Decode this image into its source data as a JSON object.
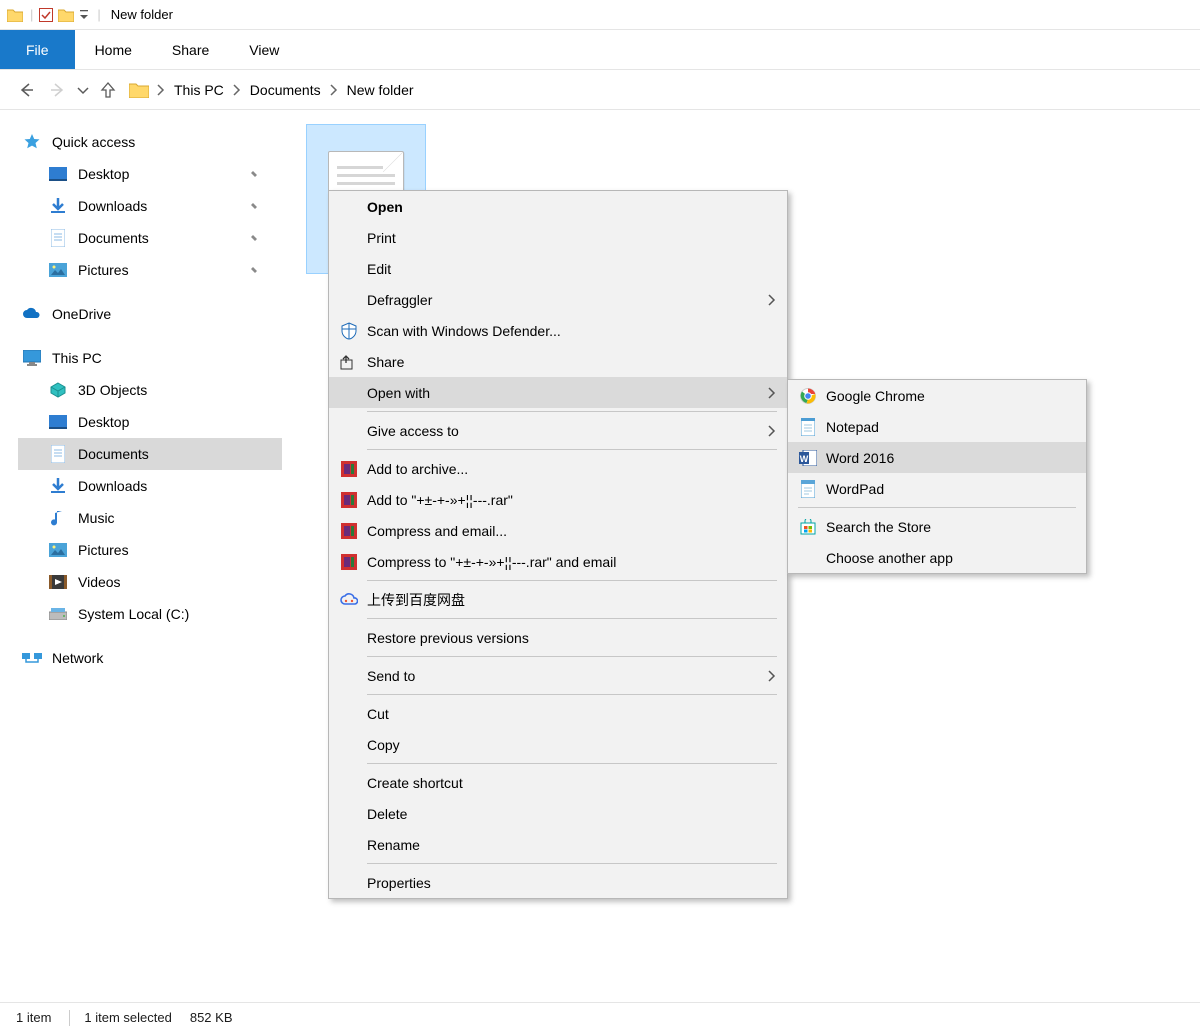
{
  "titlebar": {
    "title": "New folder"
  },
  "ribbon": {
    "file": "File",
    "tabs": [
      "Home",
      "Share",
      "View"
    ]
  },
  "breadcrumb": {
    "segments": [
      "This PC",
      "Documents",
      "New folder"
    ]
  },
  "sidebar": {
    "quick_access": "Quick access",
    "quick_items": [
      {
        "label": "Desktop"
      },
      {
        "label": "Downloads"
      },
      {
        "label": "Documents"
      },
      {
        "label": "Pictures"
      }
    ],
    "onedrive": "OneDrive",
    "this_pc": "This PC",
    "pc_items": [
      {
        "label": "3D Objects"
      },
      {
        "label": "Desktop"
      },
      {
        "label": "Documents",
        "selected": true
      },
      {
        "label": "Downloads"
      },
      {
        "label": "Music"
      },
      {
        "label": "Pictures"
      },
      {
        "label": "Videos"
      },
      {
        "label": "System Local (C:)"
      }
    ],
    "network": "Network"
  },
  "statusbar": {
    "count": "1 item",
    "selection": "1 item selected",
    "size": "852 KB"
  },
  "context_menu": {
    "open": "Open",
    "print": "Print",
    "edit": "Edit",
    "defraggler": "Defraggler",
    "defender": "Scan with Windows Defender...",
    "share": "Share",
    "open_with": "Open with",
    "give_access": "Give access to",
    "add_archive": "Add to archive...",
    "add_to_rar": "Add to \"+±-+-»+¦¦---.rar\"",
    "compress_email": "Compress and email...",
    "compress_to_email": "Compress to \"+±-+-»+¦¦---.rar\" and email",
    "baidu": "上传到百度网盘",
    "restore": "Restore previous versions",
    "send_to": "Send to",
    "cut": "Cut",
    "copy": "Copy",
    "shortcut": "Create shortcut",
    "delete": "Delete",
    "rename": "Rename",
    "properties": "Properties"
  },
  "submenu": {
    "chrome": "Google Chrome",
    "notepad": "Notepad",
    "word": "Word 2016",
    "wordpad": "WordPad",
    "store": "Search the Store",
    "choose": "Choose another app"
  }
}
